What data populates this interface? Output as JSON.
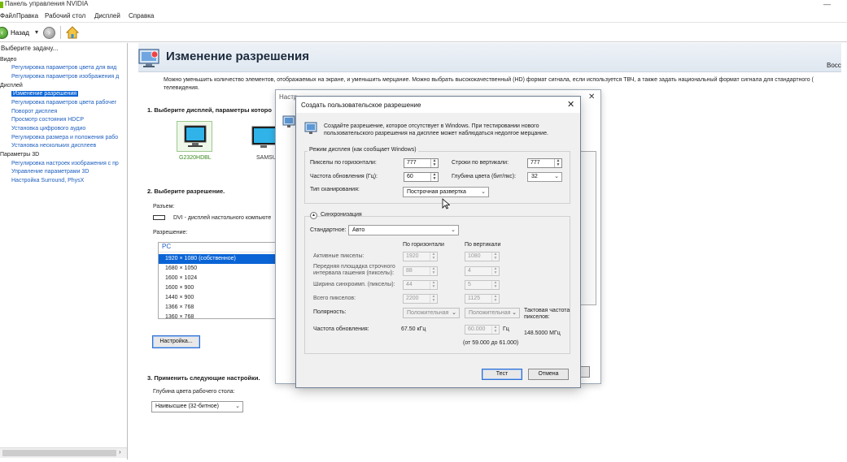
{
  "window": {
    "title": "Панель управления NVIDIA"
  },
  "menu": [
    "Файл",
    "Правка",
    "Рабочий стол",
    "Дисплей",
    "Справка"
  ],
  "toolbar": {
    "back_label": "Назад",
    "back_dropdown": "▾",
    "back_icon": "arrow-left-icon",
    "forward_icon": "arrow-right-icon",
    "home_icon": "home-icon"
  },
  "left_panel": {
    "header": "Выберите задачу...",
    "tree": [
      {
        "label": "Видео",
        "level": 0
      },
      {
        "label": "Регулировка параметров цвета для вид",
        "level": 1
      },
      {
        "label": "Регулировка параметров изображения д",
        "level": 1
      },
      {
        "label": "Дисплей",
        "level": 0
      },
      {
        "label": "Изменение разрешения",
        "level": 1,
        "selected": true
      },
      {
        "label": "Регулировка параметров цвета рабочег",
        "level": 1
      },
      {
        "label": "Поворот дисплея",
        "level": 1
      },
      {
        "label": "Просмотр состояния HDCP",
        "level": 1
      },
      {
        "label": "Установка цифрового аудио",
        "level": 1
      },
      {
        "label": "Регулировка размера и положения рабо",
        "level": 1
      },
      {
        "label": "Установка нескольких дисплеев",
        "level": 1
      },
      {
        "label": "Параметры 3D",
        "level": 0
      },
      {
        "label": "Регулировка настроек изображения с пр",
        "level": 1
      },
      {
        "label": "Управление параметрами 3D",
        "level": 1
      },
      {
        "label": "Настройка Surround, PhysX",
        "level": 1
      }
    ],
    "hscroll_arrow": "›"
  },
  "main": {
    "title": "Изменение разрешения",
    "restore": "Восста",
    "description": "Можно уменьшить количество элементов, отображаемых на экране, и уменьшить мерцание. Можно выбрать высококачественный (HD) формат сигнала, если используется ТВЧ, а также задать национальный формат сигнала для стандартного (",
    "description_tail": "телевидения.",
    "step1": "1. Выберите дисплей, параметры которо",
    "monitor1": "G2320HDBL",
    "monitor2": "SAMSU",
    "step2": "2. Выберите разрешение.",
    "connector_label": "Разъем:",
    "connector_value": "DVI - дисплей настольного компьюте",
    "resolution_label": "Разрешение:",
    "res_group": "PC",
    "resolutions": [
      "1920 × 1080 (собственное)",
      "1680 × 1050",
      "1600 × 1024",
      "1600 × 900",
      "1440 × 900",
      "1366 × 768",
      "1360 × 768"
    ],
    "customize_button": "Настройка...",
    "step3": "3. Применить следующие настройки.",
    "depth_label": "Глубина цвета рабочего стола:",
    "depth_value": "Наивысшее (32-битное)"
  },
  "bg_dialog": {
    "title": "Настр",
    "close": "✕"
  },
  "dialog": {
    "title": "Создать пользовательское разрешение",
    "close": "✕",
    "intro": "Создайте разрешение, которое отсутствует в Windows. При тестировании нового пользовательского разрешения на дисплее может наблюдаться недолгое мерцание.",
    "display_mode_group": "Режим дисплея (как сообщает Windows)",
    "h_pixels_label": "Пикселы по горизонтали:",
    "h_pixels": "777",
    "v_lines_label": "Строки по вертикали:",
    "v_lines": "777",
    "refresh_label": "Частота обновления (Гц):",
    "refresh": "60",
    "depth_label": "Глубина цвета (бит/пкс):",
    "depth": "32",
    "scan_label": "Тип сканирования:",
    "scan_value": "Построчная развертка",
    "sync_label": "Синхронизация",
    "sync_toggle": "▴",
    "standard_label": "Стандартное:",
    "standard_value": "Авто",
    "col_h": "По горизонтали",
    "col_v": "По вертикали",
    "rows": [
      {
        "label": "Активные пикселы:",
        "h": "1920",
        "v": "1080"
      },
      {
        "label": "Передняя площадка строчного интервала гашения (пикселы):",
        "h": "88",
        "v": "4"
      },
      {
        "label": "Ширина синхроимп. (пикселы):",
        "h": "44",
        "v": "5"
      },
      {
        "label": "Всего пикселов:",
        "h": "2200",
        "v": "1125"
      }
    ],
    "polarity_label": "Полярность:",
    "polarity_h": "Положительная",
    "polarity_v": "Положительная",
    "pixel_clock_label": "Тактовая частота пикселов:",
    "pixel_clock_value": "148.5000 МГц",
    "refresh_rate_label": "Частота обновления:",
    "refresh_h": "67.50 кГц",
    "refresh_v": "60.000",
    "refresh_v_unit": "Гц",
    "refresh_range": "(от 59.000 до 61.000)",
    "test_button": "Тест",
    "cancel_button": "Отмена"
  }
}
